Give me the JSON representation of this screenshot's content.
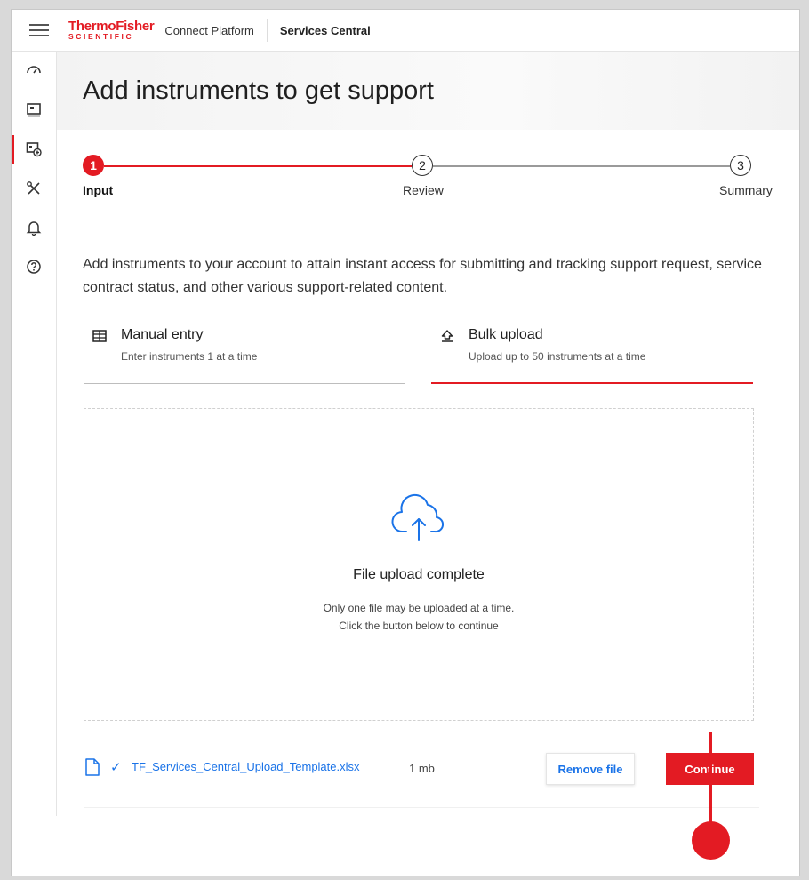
{
  "header": {
    "logo_line1": "ThermoFisher",
    "logo_line2": "SCIENTIFIC",
    "platform": "Connect Platform",
    "app_name": "Services Central"
  },
  "sidebar": {
    "items": [
      {
        "icon": "dashboard-icon",
        "active": false
      },
      {
        "icon": "instrument-icon",
        "active": false
      },
      {
        "icon": "add-instrument-icon",
        "active": true
      },
      {
        "icon": "tools-icon",
        "active": false
      },
      {
        "icon": "bell-icon",
        "active": false
      },
      {
        "icon": "help-icon",
        "active": false
      }
    ]
  },
  "page": {
    "title": "Add instruments to get support",
    "intro": "Add instruments to your account to attain instant access for submitting and tracking support request, service contract status, and other various support-related content."
  },
  "stepper": {
    "steps": [
      {
        "number": "1",
        "label": "Input",
        "active": true
      },
      {
        "number": "2",
        "label": "Review",
        "active": false
      },
      {
        "number": "3",
        "label": "Summary",
        "active": false
      }
    ]
  },
  "tabs": [
    {
      "title": "Manual entry",
      "subtitle": "Enter instruments 1 at a time",
      "icon": "table-icon",
      "selected": false
    },
    {
      "title": "Bulk upload",
      "subtitle": "Upload up to 50 instruments at a time",
      "icon": "upload-arrow-icon",
      "selected": true
    }
  ],
  "dropzone": {
    "icon": "cloud-upload-icon",
    "title": "File upload complete",
    "line1": "Only one file may be uploaded at a time.",
    "line2": "Click the button below to continue"
  },
  "file": {
    "name": "TF_Services_Central_Upload_Template.xlsx",
    "size": "1 mb",
    "status_icon": "check-icon"
  },
  "actions": {
    "remove_label": "Remove file",
    "continue_label": "Continue"
  },
  "colors": {
    "brand_red": "#e31b23",
    "link_blue": "#1a73e8"
  }
}
